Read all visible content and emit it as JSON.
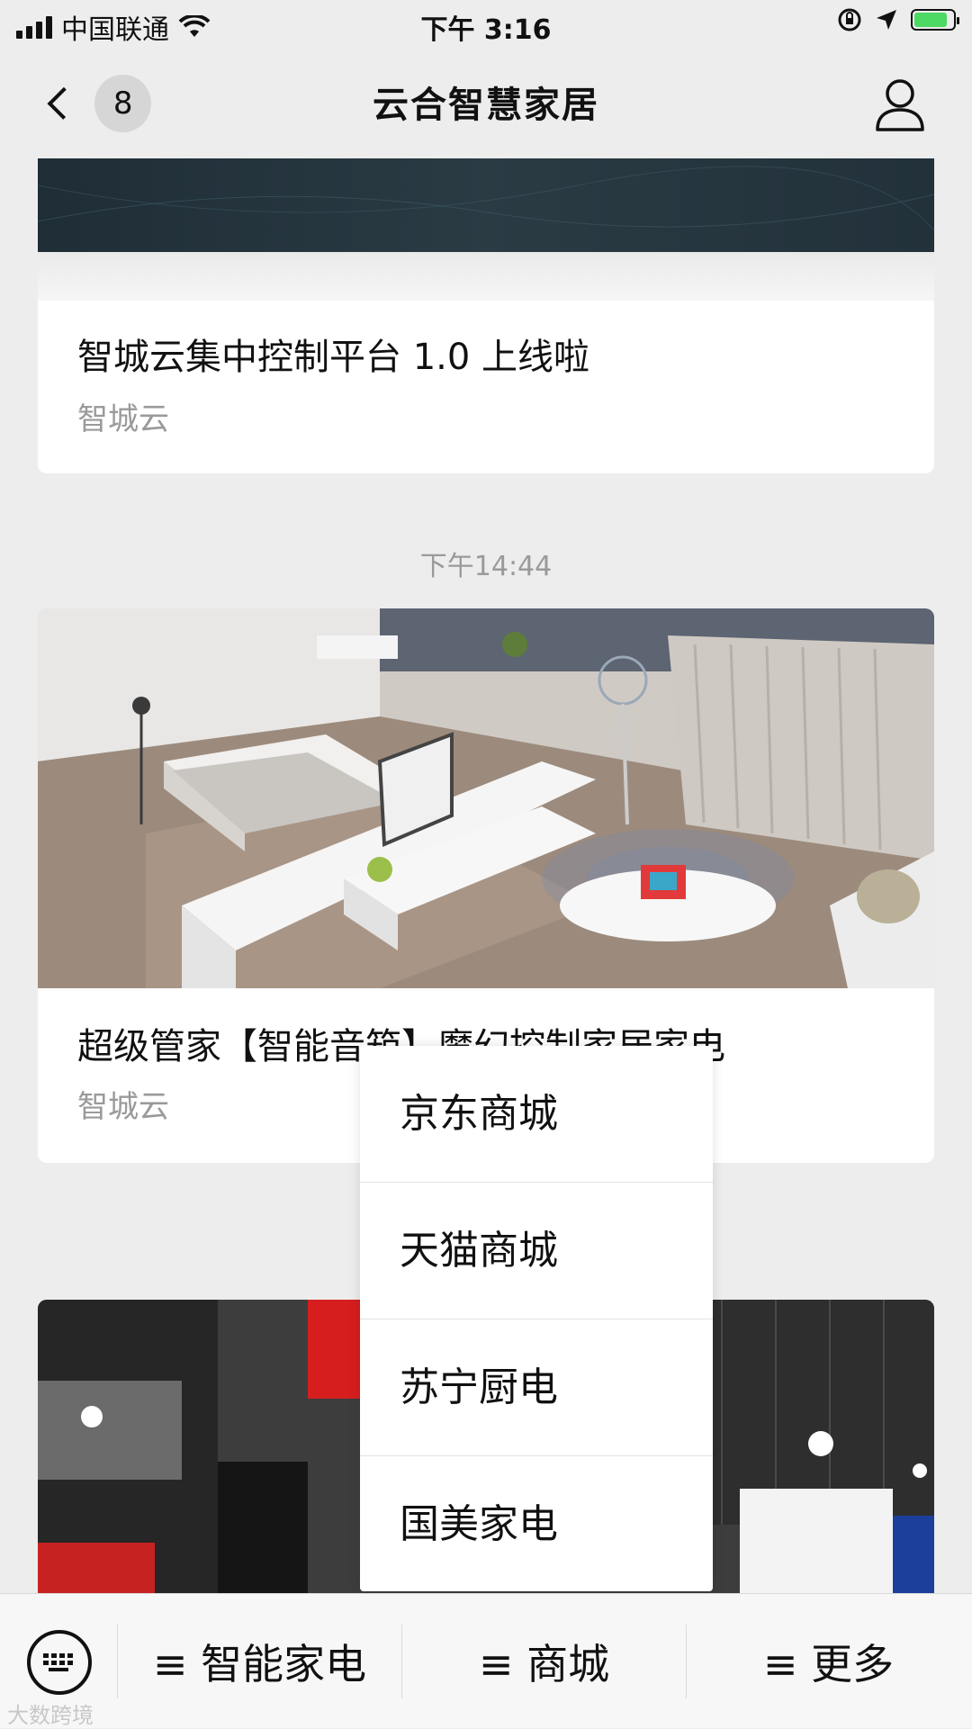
{
  "status_bar": {
    "carrier": "中国联通",
    "time": "下午 3:16"
  },
  "nav": {
    "badge_count": "8",
    "title": "云合智慧家居"
  },
  "cards": [
    {
      "title": "智城云集中控制平台 1.0 上线啦",
      "source": "智城云"
    },
    {
      "title": "超级管家【智能音箱】魔幻控制家居家电",
      "source": "智城云"
    }
  ],
  "timestamps": [
    "下午14:44"
  ],
  "popup_menu": {
    "items": [
      "京东商城",
      "天猫商城",
      "苏宁厨电",
      "国美家电"
    ]
  },
  "bottom_menu": {
    "items": [
      "≡ 智能家电",
      "≡ 商城",
      "≡ 更多"
    ]
  },
  "watermark": "大数跨境"
}
